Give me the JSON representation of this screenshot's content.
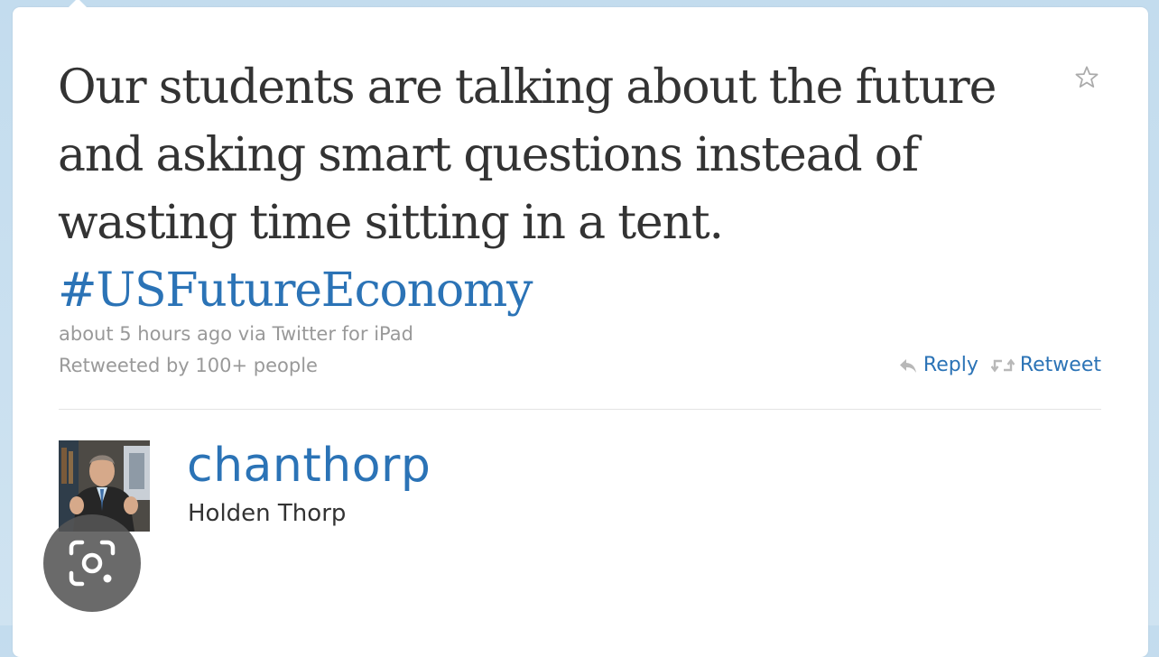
{
  "tweet": {
    "text": "Our students are talking about the future and asking smart questions instead of wasting time sitting in a tent.",
    "hashtag": "#USFutureEconomy",
    "time": "about 5 hours ago",
    "via_prefix": "via",
    "source": "Twitter for iPad",
    "retweeted_by": "Retweeted by 100+ people"
  },
  "actions": {
    "reply_label": "Reply",
    "retweet_label": "Retweet"
  },
  "author": {
    "username": "chanthorp",
    "full_name": "Holden Thorp"
  },
  "icons": {
    "favorite": "star-icon",
    "reply": "reply-arrow-icon",
    "retweet": "retweet-icon",
    "lens": "visual-search-icon"
  },
  "colors": {
    "link": "#2b73b6",
    "text": "#333333",
    "meta": "#999999",
    "background": "#c3dcee"
  }
}
